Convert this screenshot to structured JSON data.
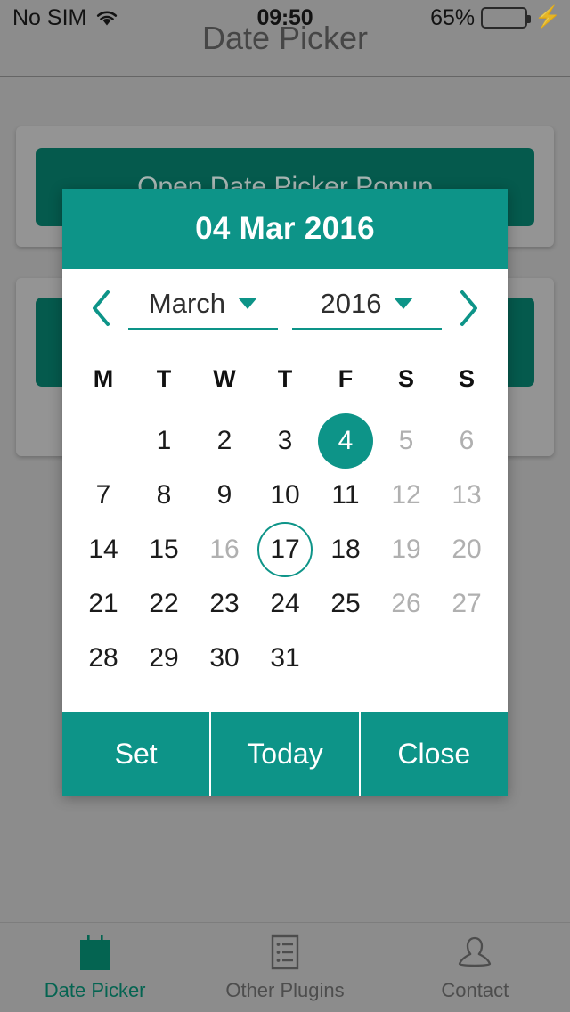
{
  "status_bar": {
    "carrier": "No SIM",
    "wifi_icon": "wifi-icon",
    "time": "09:50",
    "battery_percent": "65%",
    "battery_level": 65,
    "charging_icon": "lightning-bolt-icon"
  },
  "nav_bar": {
    "title": "Date Picker"
  },
  "page": {
    "cards": [
      {
        "button_label": "Open Date Picker Popup"
      },
      {
        "button_label": ""
      }
    ]
  },
  "dialog": {
    "header_date": "04 Mar 2016",
    "prev_icon": "chevron-left-icon",
    "next_icon": "chevron-right-icon",
    "month": {
      "value": "March",
      "caret_icon": "caret-down-icon"
    },
    "year": {
      "value": "2016",
      "caret_icon": "caret-down-icon"
    },
    "weekdays": [
      "M",
      "T",
      "W",
      "T",
      "F",
      "S",
      "S"
    ],
    "leading_blanks": 1,
    "days": [
      {
        "n": "1",
        "state": "normal"
      },
      {
        "n": "2",
        "state": "normal"
      },
      {
        "n": "3",
        "state": "normal"
      },
      {
        "n": "4",
        "state": "selected"
      },
      {
        "n": "5",
        "state": "muted"
      },
      {
        "n": "6",
        "state": "muted"
      },
      {
        "n": "7",
        "state": "normal"
      },
      {
        "n": "8",
        "state": "normal"
      },
      {
        "n": "9",
        "state": "normal"
      },
      {
        "n": "10",
        "state": "normal"
      },
      {
        "n": "11",
        "state": "normal"
      },
      {
        "n": "12",
        "state": "muted"
      },
      {
        "n": "13",
        "state": "muted"
      },
      {
        "n": "14",
        "state": "normal"
      },
      {
        "n": "15",
        "state": "normal"
      },
      {
        "n": "16",
        "state": "muted"
      },
      {
        "n": "17",
        "state": "today"
      },
      {
        "n": "18",
        "state": "normal"
      },
      {
        "n": "19",
        "state": "muted"
      },
      {
        "n": "20",
        "state": "muted"
      },
      {
        "n": "21",
        "state": "normal"
      },
      {
        "n": "22",
        "state": "normal"
      },
      {
        "n": "23",
        "state": "normal"
      },
      {
        "n": "24",
        "state": "normal"
      },
      {
        "n": "25",
        "state": "normal"
      },
      {
        "n": "26",
        "state": "muted"
      },
      {
        "n": "27",
        "state": "muted"
      },
      {
        "n": "28",
        "state": "normal"
      },
      {
        "n": "29",
        "state": "normal"
      },
      {
        "n": "30",
        "state": "normal"
      },
      {
        "n": "31",
        "state": "normal"
      }
    ],
    "actions": [
      {
        "label": "Set"
      },
      {
        "label": "Today"
      },
      {
        "label": "Close"
      }
    ]
  },
  "tab_bar": {
    "tabs": [
      {
        "label": "Date Picker",
        "icon": "calendar-icon",
        "active": true
      },
      {
        "label": "Other Plugins",
        "icon": "list-icon",
        "active": false
      },
      {
        "label": "Contact",
        "icon": "person-icon",
        "active": false
      }
    ]
  },
  "colors": {
    "accent_teal": "#0d9488",
    "dark_teal": "#006152",
    "background_gray": "#9a9a9a",
    "battery_green": "#4cd662"
  }
}
